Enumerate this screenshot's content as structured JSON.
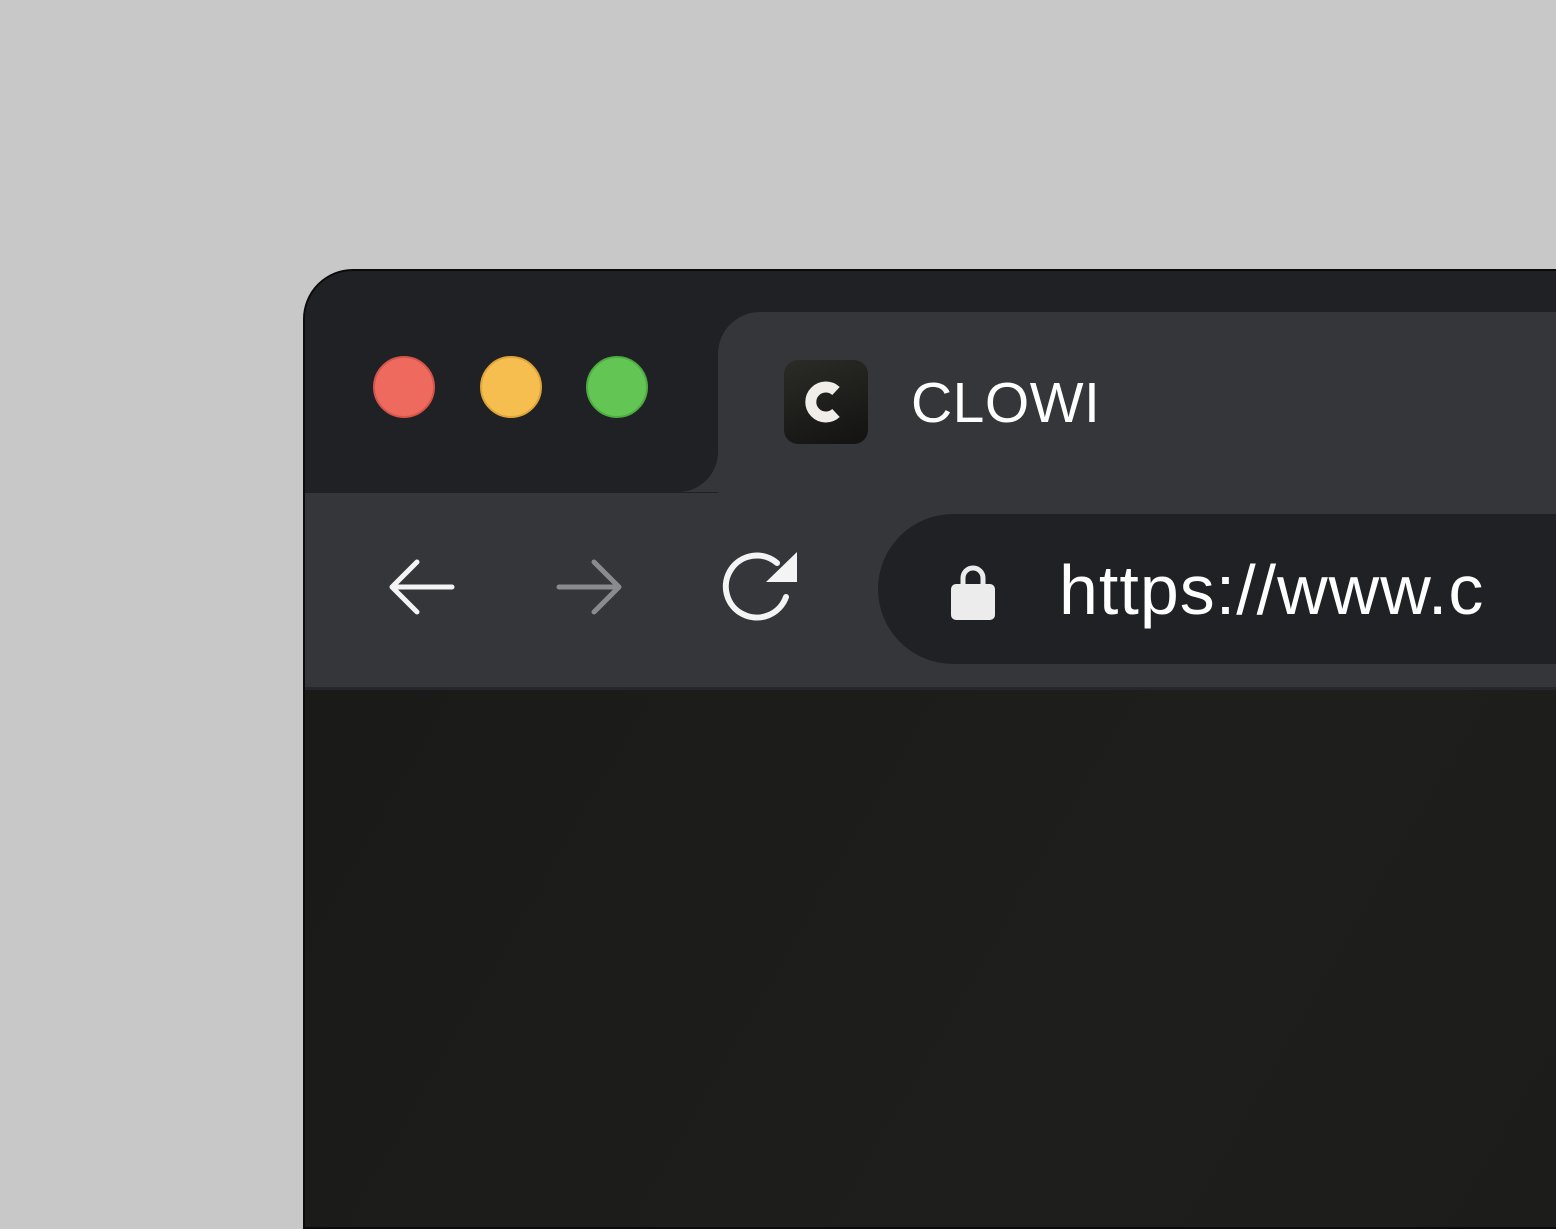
{
  "window": {
    "controls": {
      "close_color": "#ee6a5f",
      "minimize_color": "#f5be4f",
      "zoom_color": "#62c554"
    }
  },
  "tab": {
    "favicon_letter": "C",
    "title": "CLOWI"
  },
  "toolbar": {
    "back_icon": "arrow-left-icon",
    "forward_icon": "arrow-right-icon",
    "reload_icon": "reload-icon",
    "forward_enabled": false
  },
  "omnibox": {
    "lock_icon": "lock-icon",
    "url": "https://www.c"
  },
  "colors": {
    "background": "#c8c8c8",
    "titlebar": "#202124",
    "toolbar": "#35363a",
    "content": "#1c1c1a"
  }
}
